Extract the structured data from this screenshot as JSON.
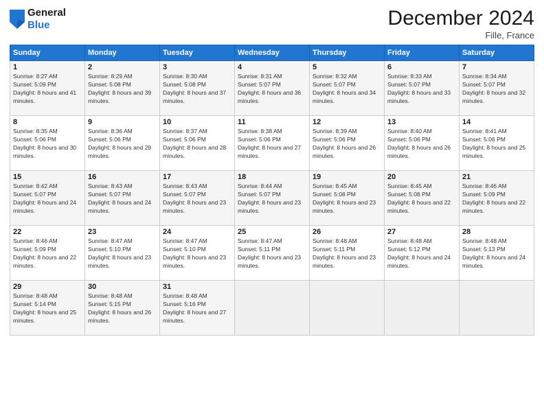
{
  "header": {
    "logo_line1": "General",
    "logo_line2": "Blue",
    "month": "December 2024",
    "location": "Fille, France"
  },
  "weekdays": [
    "Sunday",
    "Monday",
    "Tuesday",
    "Wednesday",
    "Thursday",
    "Friday",
    "Saturday"
  ],
  "weeks": [
    [
      {
        "day": "1",
        "sunrise": "Sunrise: 8:27 AM",
        "sunset": "Sunset: 5:09 PM",
        "daylight": "Daylight: 8 hours and 41 minutes."
      },
      {
        "day": "2",
        "sunrise": "Sunrise: 8:29 AM",
        "sunset": "Sunset: 5:08 PM",
        "daylight": "Daylight: 8 hours and 39 minutes."
      },
      {
        "day": "3",
        "sunrise": "Sunrise: 8:30 AM",
        "sunset": "Sunset: 5:08 PM",
        "daylight": "Daylight: 8 hours and 37 minutes."
      },
      {
        "day": "4",
        "sunrise": "Sunrise: 8:31 AM",
        "sunset": "Sunset: 5:07 PM",
        "daylight": "Daylight: 8 hours and 36 minutes."
      },
      {
        "day": "5",
        "sunrise": "Sunrise: 8:32 AM",
        "sunset": "Sunset: 5:07 PM",
        "daylight": "Daylight: 8 hours and 34 minutes."
      },
      {
        "day": "6",
        "sunrise": "Sunrise: 8:33 AM",
        "sunset": "Sunset: 5:07 PM",
        "daylight": "Daylight: 8 hours and 33 minutes."
      },
      {
        "day": "7",
        "sunrise": "Sunrise: 8:34 AM",
        "sunset": "Sunset: 5:07 PM",
        "daylight": "Daylight: 8 hours and 32 minutes."
      }
    ],
    [
      {
        "day": "8",
        "sunrise": "Sunrise: 8:35 AM",
        "sunset": "Sunset: 5:06 PM",
        "daylight": "Daylight: 8 hours and 30 minutes."
      },
      {
        "day": "9",
        "sunrise": "Sunrise: 8:36 AM",
        "sunset": "Sunset: 5:06 PM",
        "daylight": "Daylight: 8 hours and 29 minutes."
      },
      {
        "day": "10",
        "sunrise": "Sunrise: 8:37 AM",
        "sunset": "Sunset: 5:06 PM",
        "daylight": "Daylight: 8 hours and 28 minutes."
      },
      {
        "day": "11",
        "sunrise": "Sunrise: 8:38 AM",
        "sunset": "Sunset: 5:06 PM",
        "daylight": "Daylight: 8 hours and 27 minutes."
      },
      {
        "day": "12",
        "sunrise": "Sunrise: 8:39 AM",
        "sunset": "Sunset: 5:06 PM",
        "daylight": "Daylight: 8 hours and 26 minutes."
      },
      {
        "day": "13",
        "sunrise": "Sunrise: 8:40 AM",
        "sunset": "Sunset: 5:06 PM",
        "daylight": "Daylight: 8 hours and 26 minutes."
      },
      {
        "day": "14",
        "sunrise": "Sunrise: 8:41 AM",
        "sunset": "Sunset: 5:06 PM",
        "daylight": "Daylight: 8 hours and 25 minutes."
      }
    ],
    [
      {
        "day": "15",
        "sunrise": "Sunrise: 8:42 AM",
        "sunset": "Sunset: 5:07 PM",
        "daylight": "Daylight: 8 hours and 24 minutes."
      },
      {
        "day": "16",
        "sunrise": "Sunrise: 8:43 AM",
        "sunset": "Sunset: 5:07 PM",
        "daylight": "Daylight: 8 hours and 24 minutes."
      },
      {
        "day": "17",
        "sunrise": "Sunrise: 8:43 AM",
        "sunset": "Sunset: 5:07 PM",
        "daylight": "Daylight: 8 hours and 23 minutes."
      },
      {
        "day": "18",
        "sunrise": "Sunrise: 8:44 AM",
        "sunset": "Sunset: 5:07 PM",
        "daylight": "Daylight: 8 hours and 23 minutes."
      },
      {
        "day": "19",
        "sunrise": "Sunrise: 8:45 AM",
        "sunset": "Sunset: 5:08 PM",
        "daylight": "Daylight: 8 hours and 23 minutes."
      },
      {
        "day": "20",
        "sunrise": "Sunrise: 8:45 AM",
        "sunset": "Sunset: 5:08 PM",
        "daylight": "Daylight: 8 hours and 22 minutes."
      },
      {
        "day": "21",
        "sunrise": "Sunrise: 8:46 AM",
        "sunset": "Sunset: 5:09 PM",
        "daylight": "Daylight: 8 hours and 22 minutes."
      }
    ],
    [
      {
        "day": "22",
        "sunrise": "Sunrise: 8:46 AM",
        "sunset": "Sunset: 5:09 PM",
        "daylight": "Daylight: 8 hours and 22 minutes."
      },
      {
        "day": "23",
        "sunrise": "Sunrise: 8:47 AM",
        "sunset": "Sunset: 5:10 PM",
        "daylight": "Daylight: 8 hours and 23 minutes."
      },
      {
        "day": "24",
        "sunrise": "Sunrise: 8:47 AM",
        "sunset": "Sunset: 5:10 PM",
        "daylight": "Daylight: 8 hours and 23 minutes."
      },
      {
        "day": "25",
        "sunrise": "Sunrise: 8:47 AM",
        "sunset": "Sunset: 5:11 PM",
        "daylight": "Daylight: 8 hours and 23 minutes."
      },
      {
        "day": "26",
        "sunrise": "Sunrise: 8:48 AM",
        "sunset": "Sunset: 5:11 PM",
        "daylight": "Daylight: 8 hours and 23 minutes."
      },
      {
        "day": "27",
        "sunrise": "Sunrise: 8:48 AM",
        "sunset": "Sunset: 5:12 PM",
        "daylight": "Daylight: 8 hours and 24 minutes."
      },
      {
        "day": "28",
        "sunrise": "Sunrise: 8:48 AM",
        "sunset": "Sunset: 5:13 PM",
        "daylight": "Daylight: 8 hours and 24 minutes."
      }
    ],
    [
      {
        "day": "29",
        "sunrise": "Sunrise: 8:48 AM",
        "sunset": "Sunset: 5:14 PM",
        "daylight": "Daylight: 8 hours and 25 minutes."
      },
      {
        "day": "30",
        "sunrise": "Sunrise: 8:48 AM",
        "sunset": "Sunset: 5:15 PM",
        "daylight": "Daylight: 8 hours and 26 minutes."
      },
      {
        "day": "31",
        "sunrise": "Sunrise: 8:48 AM",
        "sunset": "Sunset: 5:16 PM",
        "daylight": "Daylight: 8 hours and 27 minutes."
      },
      null,
      null,
      null,
      null
    ]
  ]
}
